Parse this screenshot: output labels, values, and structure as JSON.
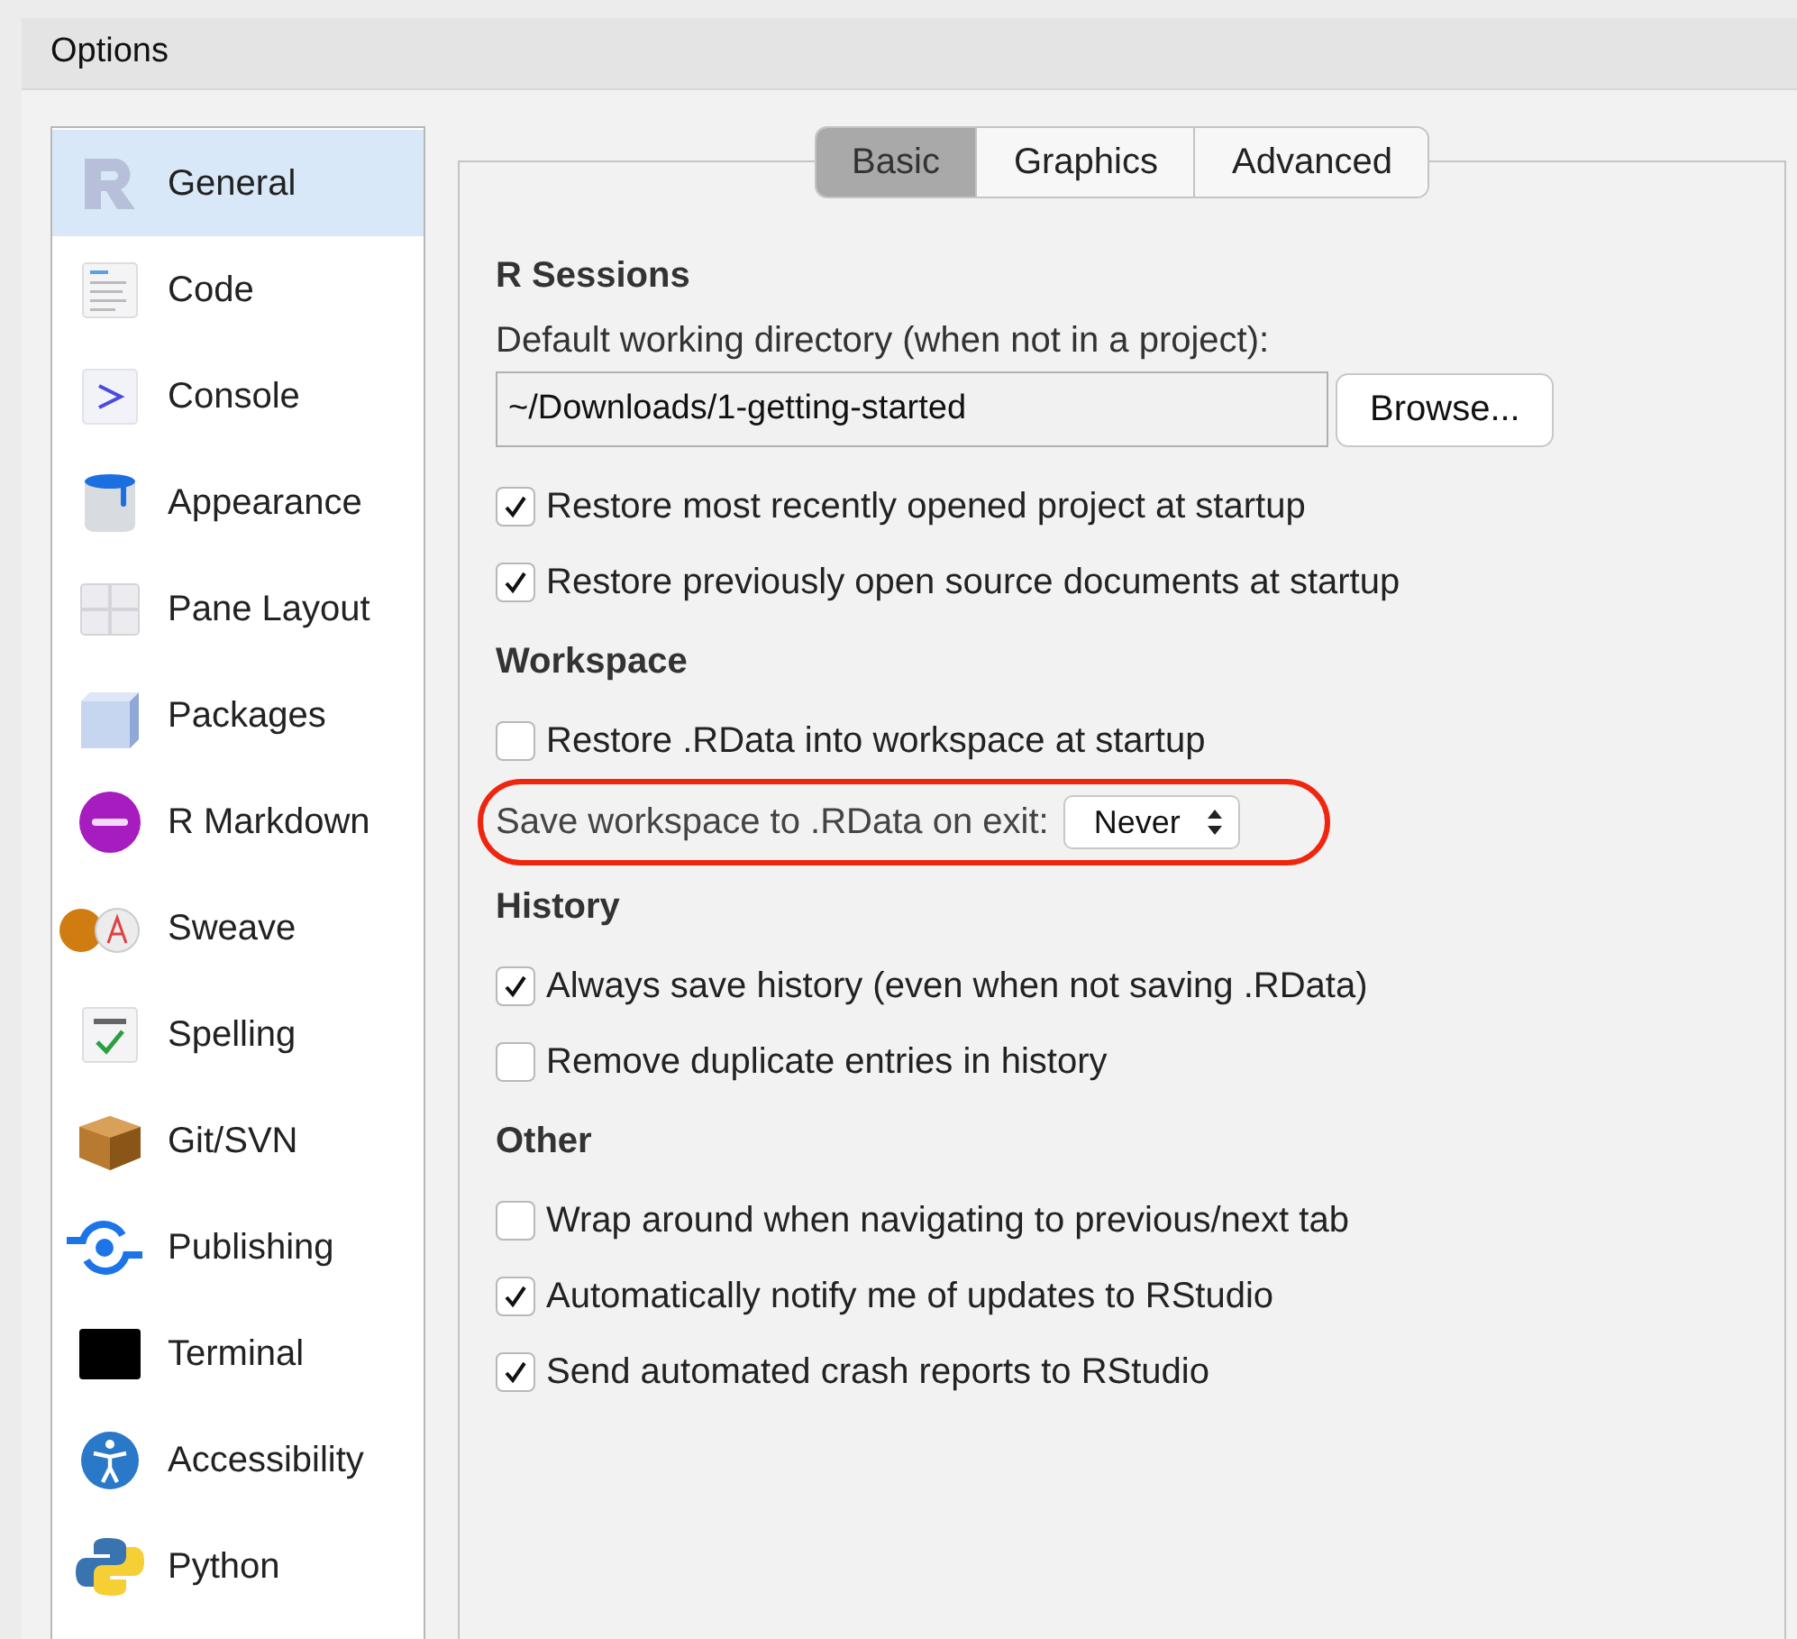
{
  "window": {
    "title": "Options"
  },
  "sidebar": {
    "items": [
      {
        "label": "General",
        "selected": true
      },
      {
        "label": "Code",
        "selected": false
      },
      {
        "label": "Console",
        "selected": false
      },
      {
        "label": "Appearance",
        "selected": false
      },
      {
        "label": "Pane Layout",
        "selected": false
      },
      {
        "label": "Packages",
        "selected": false
      },
      {
        "label": "R Markdown",
        "selected": false
      },
      {
        "label": "Sweave",
        "selected": false
      },
      {
        "label": "Spelling",
        "selected": false
      },
      {
        "label": "Git/SVN",
        "selected": false
      },
      {
        "label": "Publishing",
        "selected": false
      },
      {
        "label": "Terminal",
        "selected": false
      },
      {
        "label": "Accessibility",
        "selected": false
      },
      {
        "label": "Python",
        "selected": false
      }
    ]
  },
  "tabs": [
    {
      "label": "Basic",
      "selected": true
    },
    {
      "label": "Graphics",
      "selected": false
    },
    {
      "label": "Advanced",
      "selected": false
    }
  ],
  "sections": [
    {
      "title": "R Sessions",
      "items": [
        {
          "kind": "path",
          "label": "Default working directory (when not in a project):",
          "value": "~/Downloads/1-getting-started",
          "button": "Browse..."
        },
        {
          "kind": "checkbox",
          "label": "Restore most recently opened project at startup",
          "checked": true
        },
        {
          "kind": "checkbox",
          "label": "Restore previously open source documents at startup",
          "checked": true
        }
      ]
    },
    {
      "title": "Workspace",
      "items": [
        {
          "kind": "checkbox",
          "label": "Restore .RData into workspace at startup",
          "checked": false
        },
        {
          "kind": "select",
          "label": "Save workspace to .RData on exit:",
          "value": "Never",
          "highlighted": true
        }
      ]
    },
    {
      "title": "History",
      "items": [
        {
          "kind": "checkbox",
          "label": "Always save history (even when not saving .RData)",
          "checked": true
        },
        {
          "kind": "checkbox",
          "label": "Remove duplicate entries in history",
          "checked": false
        }
      ]
    },
    {
      "title": "Other",
      "items": [
        {
          "kind": "checkbox",
          "label": "Wrap around when navigating to previous/next tab",
          "checked": false
        },
        {
          "kind": "checkbox",
          "label": "Automatically notify me of updates to RStudio",
          "checked": true
        },
        {
          "kind": "checkbox",
          "label": "Send automated crash reports to RStudio",
          "checked": true
        }
      ]
    }
  ]
}
